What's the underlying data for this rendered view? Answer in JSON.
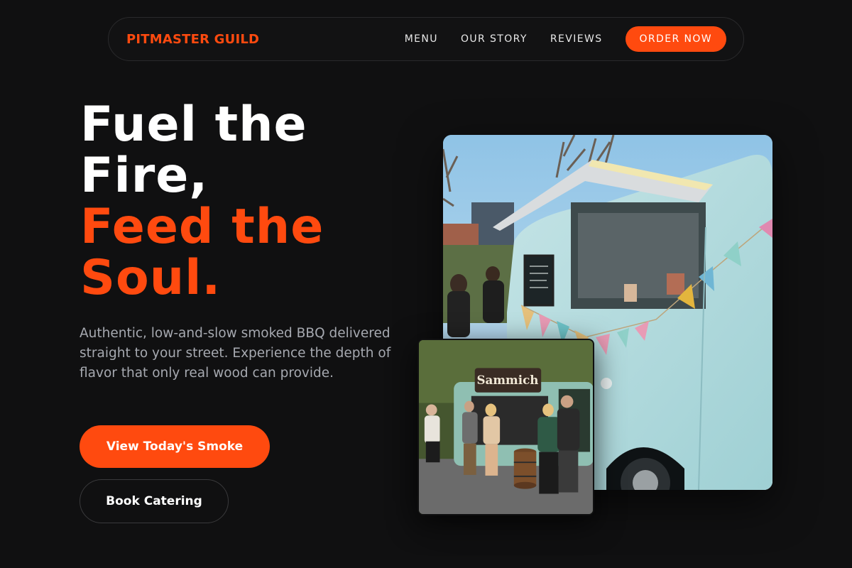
{
  "nav": {
    "brand": "PITMASTER GUILD",
    "links": [
      "MENU",
      "OUR STORY",
      "REVIEWS"
    ],
    "cta": "ORDER NOW"
  },
  "hero": {
    "title_line1": "Fuel the",
    "title_line2": "Fire,",
    "title_accent_line1": "Feed the",
    "title_accent_line2": "Soul.",
    "description": "Authentic, low-and-slow smoked BBQ delivered straight to your street. Experience the depth of flavor that only real wood can provide.",
    "primary_button": "View Today's Smoke",
    "secondary_button": "Book Catering"
  },
  "photos": {
    "small_sign": "Sammich"
  },
  "colors": {
    "accent": "#ff4a0f",
    "background": "#101011",
    "muted_text": "#a6a9b0"
  }
}
